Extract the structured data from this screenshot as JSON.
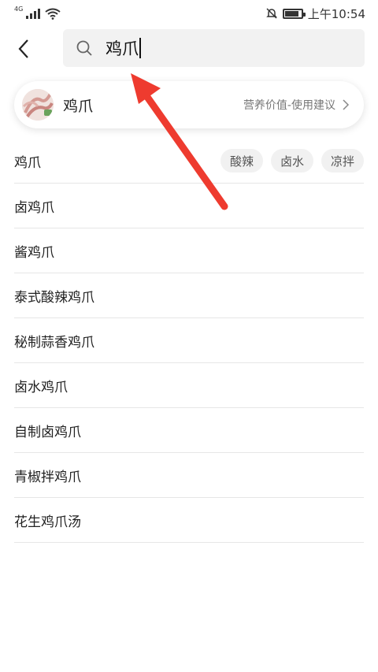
{
  "status_bar": {
    "network": "4G",
    "time": "上午10:54"
  },
  "header": {
    "back_icon": "back-chevron-icon",
    "search_value": "鸡爪",
    "search_icon": "search-icon"
  },
  "card": {
    "title": "鸡爪",
    "link": "营养价值-使用建议",
    "avatar": "chicken-feet-image"
  },
  "list": {
    "items": [
      {
        "label": "鸡爪",
        "tags": [
          "酸辣",
          "卤水",
          "凉拌"
        ]
      },
      {
        "label": "卤鸡爪"
      },
      {
        "label": "酱鸡爪"
      },
      {
        "label": "泰式酸辣鸡爪"
      },
      {
        "label": "秘制蒜香鸡爪"
      },
      {
        "label": "卤水鸡爪"
      },
      {
        "label": "自制卤鸡爪"
      },
      {
        "label": "青椒拌鸡爪"
      },
      {
        "label": "花生鸡爪汤"
      }
    ]
  },
  "colors": {
    "arrow": "#ee3b2f",
    "tag_bg": "#f1f1f1",
    "search_bg": "#f2f2f2"
  }
}
